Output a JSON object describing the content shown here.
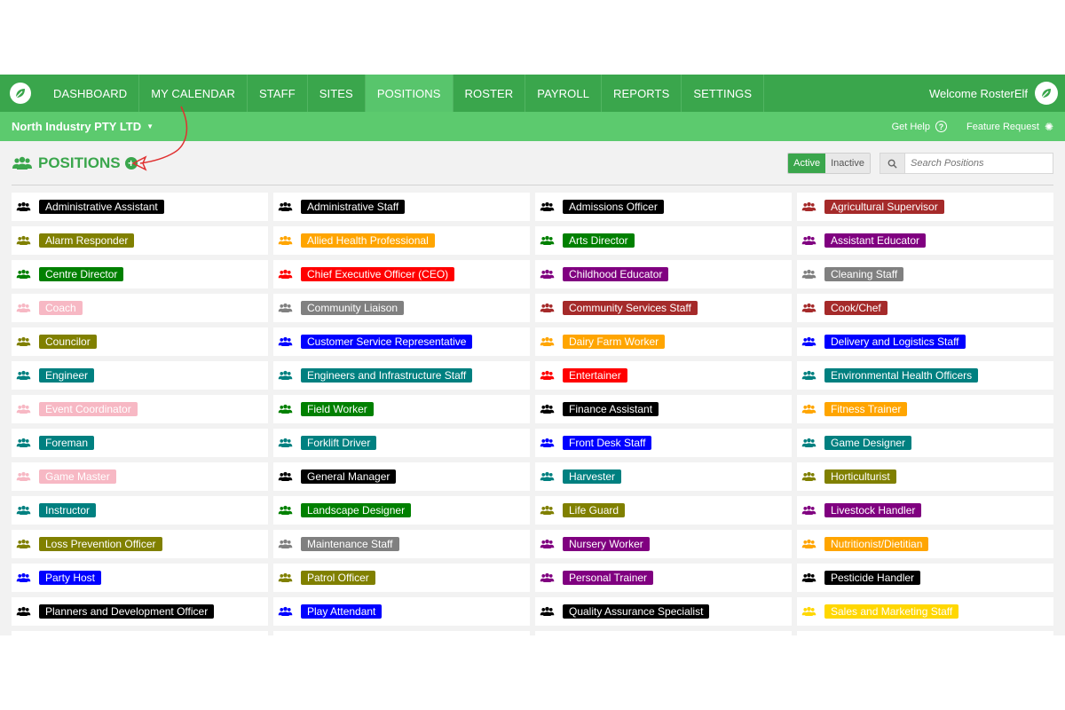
{
  "nav": {
    "items": [
      {
        "label": "DASHBOARD",
        "active": false
      },
      {
        "label": "MY CALENDAR",
        "active": false
      },
      {
        "label": "STAFF",
        "active": false
      },
      {
        "label": "SITES",
        "active": false
      },
      {
        "label": "POSITIONS",
        "active": true
      },
      {
        "label": "ROSTER",
        "active": false
      },
      {
        "label": "PAYROLL",
        "active": false
      },
      {
        "label": "REPORTS",
        "active": false
      },
      {
        "label": "SETTINGS",
        "active": false
      }
    ],
    "welcome": "Welcome RosterElf"
  },
  "subbar": {
    "company": "North Industry PTY LTD",
    "help": "Get Help",
    "feature": "Feature Request"
  },
  "page": {
    "title": "POSITIONS",
    "active_label": "Active",
    "inactive_label": "Inactive",
    "search_placeholder": "Search Positions"
  },
  "colors": {
    "black": "#000000",
    "olive": "#808000",
    "green": "#008000",
    "pink": "#f7b8c4",
    "teal": "#008080",
    "orange": "#ffa500",
    "red": "#ff0000",
    "gray": "#808080",
    "blue": "#0000ff",
    "purple": "#800080",
    "brown": "#a52a2a",
    "gold": "#ffd700"
  },
  "positions": [
    {
      "name": "Administrative Assistant",
      "color": "black"
    },
    {
      "name": "Administrative Staff",
      "color": "black"
    },
    {
      "name": "Admissions Officer",
      "color": "black"
    },
    {
      "name": "Agricultural Supervisor",
      "color": "brown"
    },
    {
      "name": "Alarm Responder",
      "color": "olive"
    },
    {
      "name": "Allied Health Professional",
      "color": "orange"
    },
    {
      "name": "Arts Director",
      "color": "green"
    },
    {
      "name": "Assistant Educator",
      "color": "purple"
    },
    {
      "name": "Centre Director",
      "color": "green"
    },
    {
      "name": "Chief Executive Officer (CEO)",
      "color": "red"
    },
    {
      "name": "Childhood Educator",
      "color": "purple"
    },
    {
      "name": "Cleaning Staff",
      "color": "gray"
    },
    {
      "name": "Coach",
      "color": "pink"
    },
    {
      "name": "Community Liaison",
      "color": "gray"
    },
    {
      "name": "Community Services Staff",
      "color": "brown"
    },
    {
      "name": "Cook/Chef",
      "color": "brown"
    },
    {
      "name": "Councilor",
      "color": "olive"
    },
    {
      "name": "Customer Service Representative",
      "color": "blue"
    },
    {
      "name": "Dairy Farm Worker",
      "color": "orange"
    },
    {
      "name": "Delivery and Logistics Staff",
      "color": "blue"
    },
    {
      "name": "Engineer",
      "color": "teal"
    },
    {
      "name": "Engineers and Infrastructure Staff",
      "color": "teal"
    },
    {
      "name": "Entertainer",
      "color": "red"
    },
    {
      "name": "Environmental Health Officers",
      "color": "teal"
    },
    {
      "name": "Event Coordinator",
      "color": "pink"
    },
    {
      "name": "Field Worker",
      "color": "green"
    },
    {
      "name": "Finance Assistant",
      "color": "black"
    },
    {
      "name": "Fitness Trainer",
      "color": "orange"
    },
    {
      "name": "Foreman",
      "color": "teal"
    },
    {
      "name": "Forklift Driver",
      "color": "teal"
    },
    {
      "name": "Front Desk Staff",
      "color": "blue"
    },
    {
      "name": "Game Designer",
      "color": "teal"
    },
    {
      "name": "Game Master",
      "color": "pink"
    },
    {
      "name": "General Manager",
      "color": "black"
    },
    {
      "name": "Harvester",
      "color": "teal"
    },
    {
      "name": "Horticulturist",
      "color": "olive"
    },
    {
      "name": "Instructor",
      "color": "teal"
    },
    {
      "name": "Landscape Designer",
      "color": "green"
    },
    {
      "name": "Life Guard",
      "color": "olive"
    },
    {
      "name": "Livestock Handler",
      "color": "purple"
    },
    {
      "name": "Loss Prevention Officer",
      "color": "olive"
    },
    {
      "name": "Maintenance Staff",
      "color": "gray"
    },
    {
      "name": "Nursery Worker",
      "color": "purple"
    },
    {
      "name": "Nutritionist/Dietitian",
      "color": "orange"
    },
    {
      "name": "Party Host",
      "color": "blue"
    },
    {
      "name": "Patrol Officer",
      "color": "olive"
    },
    {
      "name": "Personal Trainer",
      "color": "purple"
    },
    {
      "name": "Pesticide Handler",
      "color": "black"
    },
    {
      "name": "Planners and Development Officer",
      "color": "black"
    },
    {
      "name": "Play Attendant",
      "color": "blue"
    },
    {
      "name": "Quality Assurance Specialist",
      "color": "black"
    },
    {
      "name": "Sales and Marketing Staff",
      "color": "gold"
    }
  ]
}
